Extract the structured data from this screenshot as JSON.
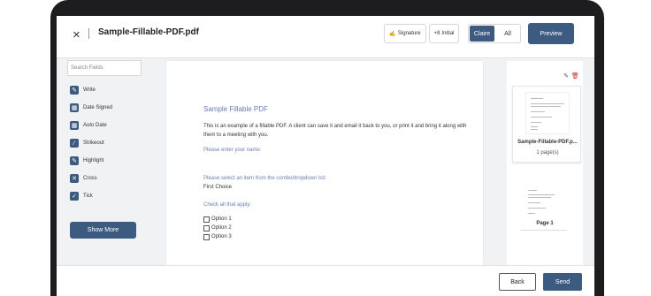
{
  "header": {
    "close_icon": "×",
    "title": "Sample-Fillable-PDF.pdf",
    "signature_icon": "✍",
    "signature_label": "Signature",
    "initial_icon": "+8",
    "initial_label": "Initial",
    "recipient_options": [
      "Claire",
      "All"
    ],
    "selected_recipient": "Claire",
    "preview_label": "Preview"
  },
  "sidebar": {
    "search_placeholder": "Search Fields",
    "fields": [
      {
        "label": "Write",
        "icon": "✎",
        "icon_name": "pencil-icon"
      },
      {
        "label": "Date Signed",
        "icon": "▦",
        "icon_name": "calendar-icon"
      },
      {
        "label": "Auto Date",
        "icon": "▦",
        "icon_name": "calendar-icon"
      },
      {
        "label": "Strikeout",
        "icon": "⁄",
        "icon_name": "strikeout-icon"
      },
      {
        "label": "Highlight",
        "icon": "✎",
        "icon_name": "highlighter-icon"
      },
      {
        "label": "Cross",
        "icon": "✕",
        "icon_name": "cross-icon"
      },
      {
        "label": "Tick",
        "icon": "✓",
        "icon_name": "check-icon"
      }
    ],
    "show_more_label": "Show More"
  },
  "document": {
    "title": "Sample Fillable PDF",
    "intro": "This is an example of a fillable PDF. A client can save it and email it back to you, or print it and bring it along with them to a meeting with you.",
    "name_prompt": "Please enter your name:",
    "combo_prompt": "Please select an item from the combo/dropdown list:",
    "combo_value": "First Choice",
    "check_prompt": "Check all that apply:",
    "options": [
      "Option 1",
      "Option 2",
      "Option 3"
    ]
  },
  "thumbnails": {
    "edit_icon": "✎",
    "delete_icon": "🗑",
    "file_name": "Sample-Fillable-PDF.p...",
    "page_count": "1 page(s)",
    "page_label": "Page 1"
  },
  "footer": {
    "back_label": "Back",
    "send_label": "Send"
  },
  "colors": {
    "accent": "#3d5a80",
    "link_text": "#6a7db0",
    "delete": "#c62828"
  }
}
